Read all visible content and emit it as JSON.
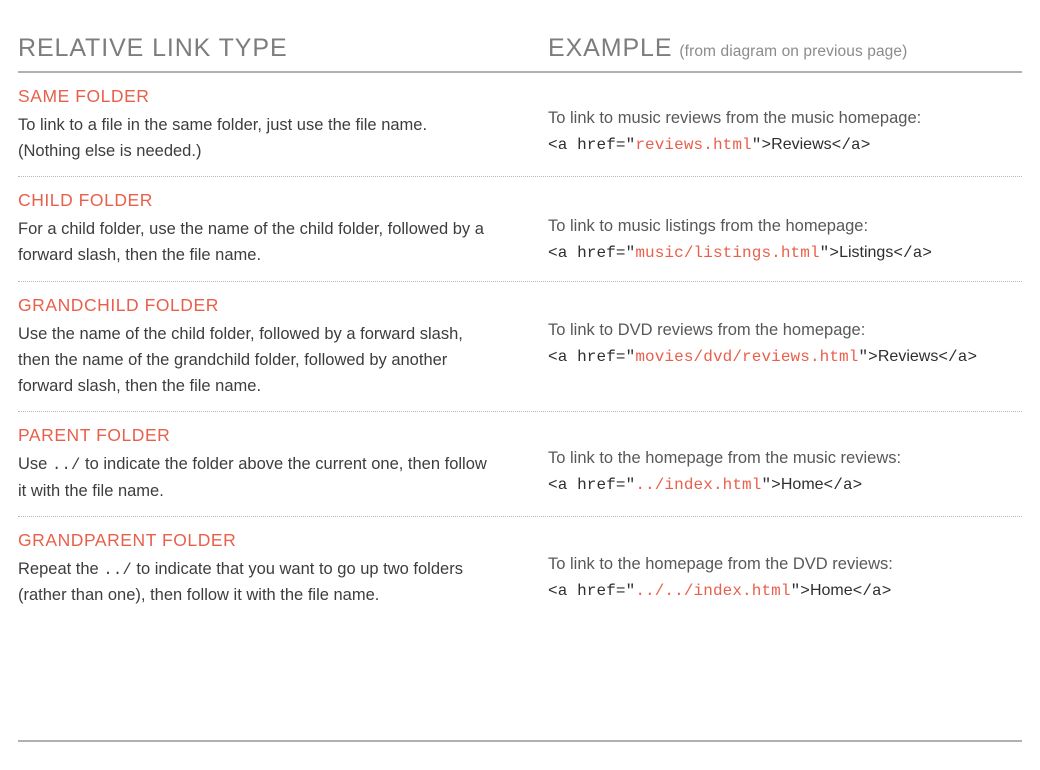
{
  "header": {
    "left_title": "RELATIVE LINK TYPE",
    "right_title": "EXAMPLE",
    "right_note": "(from diagram on previous page)"
  },
  "rows": [
    {
      "title": "SAME FOLDER",
      "desc_before": "To link to a file in the same folder, just use the file name. (Nothing else is needed.)",
      "desc_code": "",
      "desc_after": "",
      "example_caption": "To link to music reviews from the music homepage:",
      "code_prefix": "<a href=\"",
      "code_path": "reviews.html",
      "code_suffix_quote": "\">",
      "code_linktext": "Reviews",
      "code_close": "</a>"
    },
    {
      "title": "CHILD FOLDER",
      "desc_before": "For a child folder, use the name of the child folder, followed by a forward slash, then the file name.",
      "desc_code": "",
      "desc_after": "",
      "example_caption": "To link to music listings from the homepage:",
      "code_prefix": "<a href=\"",
      "code_path": "music/listings.html",
      "code_suffix_quote": "\">",
      "code_linktext": "Listings",
      "code_close": "</a>"
    },
    {
      "title": "GRANDCHILD FOLDER",
      "desc_before": "Use the name of the child folder, followed by a forward slash, then the name of the grandchild folder, followed by another forward slash, then the file name.",
      "desc_code": "",
      "desc_after": "",
      "example_caption": "To link to DVD reviews from the homepage:",
      "code_prefix": "<a href=\"",
      "code_path": "movies/dvd/reviews.html",
      "code_suffix_quote": "\">",
      "code_linktext": "Reviews",
      "code_close": "</a>"
    },
    {
      "title": "PARENT FOLDER",
      "desc_before": "Use ",
      "desc_code": "../",
      "desc_after": " to indicate the folder above the current one, then follow it with the file name.",
      "example_caption": "To link to the homepage from the music reviews:",
      "code_prefix": "<a href=\"",
      "code_path": "../index.html",
      "code_suffix_quote": "\">",
      "code_linktext": "Home",
      "code_close": "</a>"
    },
    {
      "title": "GRANDPARENT FOLDER",
      "desc_before": "Repeat the ",
      "desc_code": "../",
      "desc_after": " to indicate that you want to go up two folders (rather than one), then follow it with the file name.",
      "example_caption": "To link to the homepage from the DVD reviews:",
      "code_prefix": "<a href=\"",
      "code_path": "../../index.html",
      "code_suffix_quote": "\">",
      "code_linktext": "Home",
      "code_close": "</a>"
    }
  ],
  "colors": {
    "accent": "#e8604c",
    "heading_gray": "#7d7d7d",
    "body": "#3d3d3d",
    "rule": "#b0b0b0",
    "dotted_rule": "#b9b9b9"
  }
}
